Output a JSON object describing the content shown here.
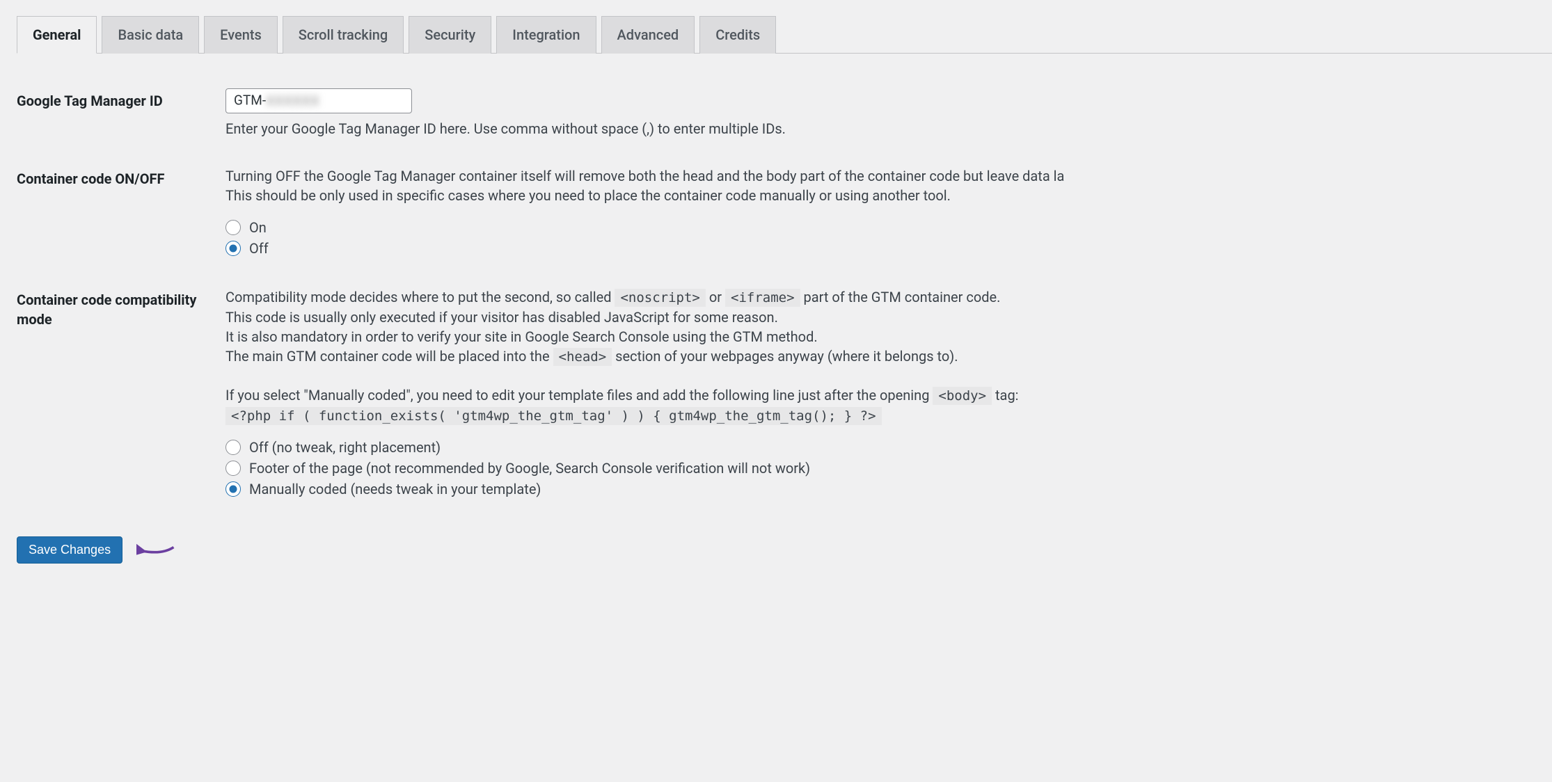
{
  "tabs": [
    {
      "label": "General",
      "active": true
    },
    {
      "label": "Basic data",
      "active": false
    },
    {
      "label": "Events",
      "active": false
    },
    {
      "label": "Scroll tracking",
      "active": false
    },
    {
      "label": "Security",
      "active": false
    },
    {
      "label": "Integration",
      "active": false
    },
    {
      "label": "Advanced",
      "active": false
    },
    {
      "label": "Credits",
      "active": false
    }
  ],
  "fields": {
    "gtm_id": {
      "label": "Google Tag Manager ID",
      "value_prefix": "GTM-",
      "value_masked": "XXXXXX",
      "help": "Enter your Google Tag Manager ID here. Use comma without space (,) to enter multiple IDs."
    },
    "container_onoff": {
      "label": "Container code ON/OFF",
      "desc_line1": "Turning OFF the Google Tag Manager container itself will remove both the head and the body part of the container code but leave data la",
      "desc_line2": "This should be only used in specific cases where you need to place the container code manually or using another tool.",
      "options": [
        {
          "label": "On",
          "checked": false
        },
        {
          "label": "Off",
          "checked": true
        }
      ]
    },
    "compat_mode": {
      "label": "Container code compatibility mode",
      "desc_line1_a": "Compatibility mode decides where to put the second, so called ",
      "code1": "<noscript>",
      "desc_line1_b": " or ",
      "code2": "<iframe>",
      "desc_line1_c": " part of the GTM container code.",
      "desc_line2": "This code is usually only executed if your visitor has disabled JavaScript for some reason.",
      "desc_line3": "It is also mandatory in order to verify your site in Google Search Console using the GTM method.",
      "desc_line4_a": "The main GTM container code will be placed into the ",
      "code3": "<head>",
      "desc_line4_b": " section of your webpages anyway (where it belongs to).",
      "desc_line5_a": "If you select \"Manually coded\", you need to edit your template files and add the following line just after the opening ",
      "code4": "<body>",
      "desc_line5_b": " tag:",
      "code_block": "<?php if ( function_exists( 'gtm4wp_the_gtm_tag' ) ) { gtm4wp_the_gtm_tag(); } ?>",
      "options": [
        {
          "label": "Off (no tweak, right placement)",
          "checked": false
        },
        {
          "label": "Footer of the page (not recommended by Google, Search Console verification will not work)",
          "checked": false
        },
        {
          "label": "Manually coded (needs tweak in your template)",
          "checked": true
        }
      ]
    }
  },
  "submit": {
    "label": "Save Changes"
  }
}
